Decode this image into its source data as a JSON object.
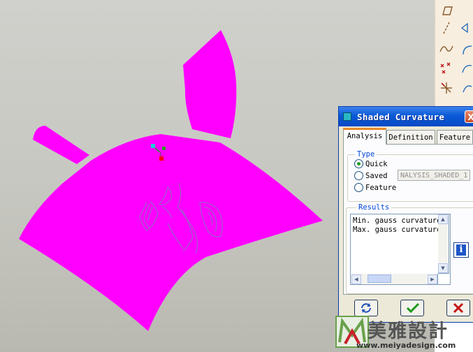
{
  "dialog": {
    "title": "Shaded Curvature",
    "close_glyph": "X",
    "tabs": [
      {
        "label": "Analysis",
        "active": true
      },
      {
        "label": "Definition",
        "active": false
      },
      {
        "label": "Feature",
        "active": false
      }
    ],
    "type_group": {
      "label": "Type",
      "options": [
        {
          "label": "Quick",
          "checked": true
        },
        {
          "label": "Saved",
          "checked": false
        },
        {
          "label": "Feature",
          "checked": false
        }
      ],
      "saved_name": "NALYSIS_SHADED_1"
    },
    "results_group": {
      "label": "Results",
      "lines": [
        "Min. gauss curvature",
        "Max. gauss curvature"
      ]
    },
    "info_glyph": "i",
    "actions": {
      "repeat_icon": "repeat-icon",
      "ok_icon": "checkmark-icon",
      "cancel_icon": "close-icon"
    }
  },
  "toolbar": {
    "icons": [
      "plane-icon",
      "axis-icon",
      "datum-axis-icon",
      "sketch-icon",
      "curve-icon",
      "extend-icon",
      "point-icon",
      "csys-icon",
      "csys-alt-icon"
    ]
  },
  "watermark": {
    "chinese_text": "美雅設計",
    "url": "www.meiyadesign.com"
  },
  "colors": {
    "surface": "#ff00ff",
    "viewport_bg": "#c8c8c2",
    "titlebar": "#0a59d6",
    "accent_tab": "#e68b2c"
  }
}
